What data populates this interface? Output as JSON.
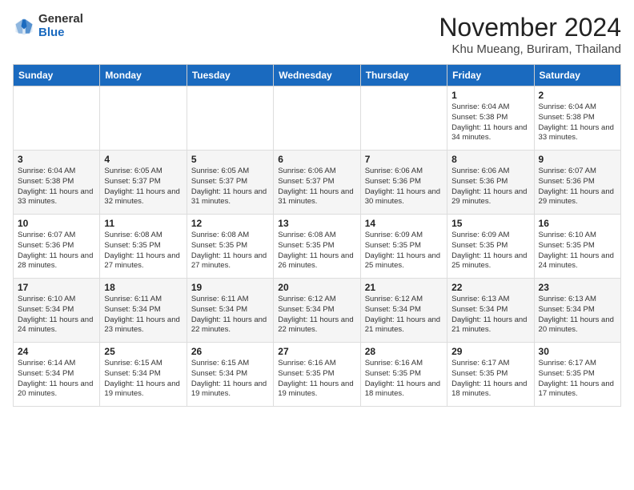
{
  "logo": {
    "general": "General",
    "blue": "Blue"
  },
  "title": "November 2024",
  "subtitle": "Khu Mueang, Buriram, Thailand",
  "days_of_week": [
    "Sunday",
    "Monday",
    "Tuesday",
    "Wednesday",
    "Thursday",
    "Friday",
    "Saturday"
  ],
  "weeks": [
    [
      {
        "day": "",
        "info": ""
      },
      {
        "day": "",
        "info": ""
      },
      {
        "day": "",
        "info": ""
      },
      {
        "day": "",
        "info": ""
      },
      {
        "day": "",
        "info": ""
      },
      {
        "day": "1",
        "info": "Sunrise: 6:04 AM\nSunset: 5:38 PM\nDaylight: 11 hours and 34 minutes."
      },
      {
        "day": "2",
        "info": "Sunrise: 6:04 AM\nSunset: 5:38 PM\nDaylight: 11 hours and 33 minutes."
      }
    ],
    [
      {
        "day": "3",
        "info": "Sunrise: 6:04 AM\nSunset: 5:38 PM\nDaylight: 11 hours and 33 minutes."
      },
      {
        "day": "4",
        "info": "Sunrise: 6:05 AM\nSunset: 5:37 PM\nDaylight: 11 hours and 32 minutes."
      },
      {
        "day": "5",
        "info": "Sunrise: 6:05 AM\nSunset: 5:37 PM\nDaylight: 11 hours and 31 minutes."
      },
      {
        "day": "6",
        "info": "Sunrise: 6:06 AM\nSunset: 5:37 PM\nDaylight: 11 hours and 31 minutes."
      },
      {
        "day": "7",
        "info": "Sunrise: 6:06 AM\nSunset: 5:36 PM\nDaylight: 11 hours and 30 minutes."
      },
      {
        "day": "8",
        "info": "Sunrise: 6:06 AM\nSunset: 5:36 PM\nDaylight: 11 hours and 29 minutes."
      },
      {
        "day": "9",
        "info": "Sunrise: 6:07 AM\nSunset: 5:36 PM\nDaylight: 11 hours and 29 minutes."
      }
    ],
    [
      {
        "day": "10",
        "info": "Sunrise: 6:07 AM\nSunset: 5:36 PM\nDaylight: 11 hours and 28 minutes."
      },
      {
        "day": "11",
        "info": "Sunrise: 6:08 AM\nSunset: 5:35 PM\nDaylight: 11 hours and 27 minutes."
      },
      {
        "day": "12",
        "info": "Sunrise: 6:08 AM\nSunset: 5:35 PM\nDaylight: 11 hours and 27 minutes."
      },
      {
        "day": "13",
        "info": "Sunrise: 6:08 AM\nSunset: 5:35 PM\nDaylight: 11 hours and 26 minutes."
      },
      {
        "day": "14",
        "info": "Sunrise: 6:09 AM\nSunset: 5:35 PM\nDaylight: 11 hours and 25 minutes."
      },
      {
        "day": "15",
        "info": "Sunrise: 6:09 AM\nSunset: 5:35 PM\nDaylight: 11 hours and 25 minutes."
      },
      {
        "day": "16",
        "info": "Sunrise: 6:10 AM\nSunset: 5:35 PM\nDaylight: 11 hours and 24 minutes."
      }
    ],
    [
      {
        "day": "17",
        "info": "Sunrise: 6:10 AM\nSunset: 5:34 PM\nDaylight: 11 hours and 24 minutes."
      },
      {
        "day": "18",
        "info": "Sunrise: 6:11 AM\nSunset: 5:34 PM\nDaylight: 11 hours and 23 minutes."
      },
      {
        "day": "19",
        "info": "Sunrise: 6:11 AM\nSunset: 5:34 PM\nDaylight: 11 hours and 22 minutes."
      },
      {
        "day": "20",
        "info": "Sunrise: 6:12 AM\nSunset: 5:34 PM\nDaylight: 11 hours and 22 minutes."
      },
      {
        "day": "21",
        "info": "Sunrise: 6:12 AM\nSunset: 5:34 PM\nDaylight: 11 hours and 21 minutes."
      },
      {
        "day": "22",
        "info": "Sunrise: 6:13 AM\nSunset: 5:34 PM\nDaylight: 11 hours and 21 minutes."
      },
      {
        "day": "23",
        "info": "Sunrise: 6:13 AM\nSunset: 5:34 PM\nDaylight: 11 hours and 20 minutes."
      }
    ],
    [
      {
        "day": "24",
        "info": "Sunrise: 6:14 AM\nSunset: 5:34 PM\nDaylight: 11 hours and 20 minutes."
      },
      {
        "day": "25",
        "info": "Sunrise: 6:15 AM\nSunset: 5:34 PM\nDaylight: 11 hours and 19 minutes."
      },
      {
        "day": "26",
        "info": "Sunrise: 6:15 AM\nSunset: 5:34 PM\nDaylight: 11 hours and 19 minutes."
      },
      {
        "day": "27",
        "info": "Sunrise: 6:16 AM\nSunset: 5:35 PM\nDaylight: 11 hours and 19 minutes."
      },
      {
        "day": "28",
        "info": "Sunrise: 6:16 AM\nSunset: 5:35 PM\nDaylight: 11 hours and 18 minutes."
      },
      {
        "day": "29",
        "info": "Sunrise: 6:17 AM\nSunset: 5:35 PM\nDaylight: 11 hours and 18 minutes."
      },
      {
        "day": "30",
        "info": "Sunrise: 6:17 AM\nSunset: 5:35 PM\nDaylight: 11 hours and 17 minutes."
      }
    ]
  ]
}
